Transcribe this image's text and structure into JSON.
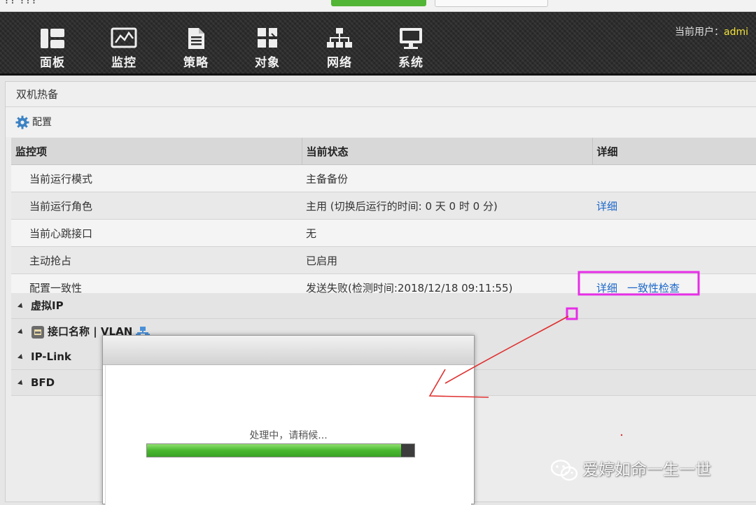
{
  "browser": {
    "tab_fragment": "? ?? ???"
  },
  "nav": {
    "items": [
      {
        "label": "面板",
        "icon": "dashboard-icon"
      },
      {
        "label": "监控",
        "icon": "monitor-chart-icon"
      },
      {
        "label": "策略",
        "icon": "document-icon"
      },
      {
        "label": "对象",
        "icon": "objects-icon"
      },
      {
        "label": "网络",
        "icon": "network-tree-icon"
      },
      {
        "label": "系统",
        "icon": "computer-icon"
      }
    ],
    "user_label": "当前用户：",
    "user_name": "admi"
  },
  "panel": {
    "title": "双机热备",
    "config_label": "配置"
  },
  "table": {
    "headers": [
      "监控项",
      "当前状态",
      "详细"
    ],
    "rows": [
      {
        "item": "当前运行模式",
        "status": "主备备份",
        "links": []
      },
      {
        "item": "当前运行角色",
        "status": "主用 (切换后运行的时间: 0 天 0 时 0 分)",
        "links": [
          "详细"
        ]
      },
      {
        "item": "当前心跳接口",
        "status": "无",
        "links": []
      },
      {
        "item": "主动抢占",
        "status": "已启用",
        "links": []
      },
      {
        "item": "配置一致性",
        "status": "发送失败(检测时间:2018/12/18 09:11:55)",
        "links": [
          "详细",
          "一致性检查"
        ]
      }
    ]
  },
  "sections": [
    "虚拟IP",
    "接口名称 | VLAN",
    "IP-Link",
    "BFD"
  ],
  "modal": {
    "message": "处理中，请稍候...",
    "progress": 0.95
  },
  "watermark": "爱婷如命一生一世",
  "colors": {
    "link": "#1a66c9",
    "highlight": "#e62ee6",
    "annotation": "#e03030",
    "progress": "#4cbb30",
    "user_name": "#f3e23a"
  }
}
